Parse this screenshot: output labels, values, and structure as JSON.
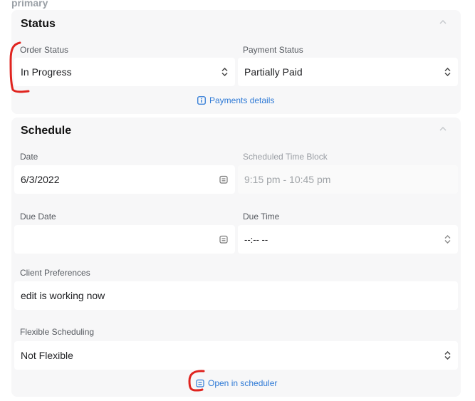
{
  "top_label": "primary",
  "status": {
    "title": "Status",
    "order_status": {
      "label": "Order Status",
      "value": "In Progress"
    },
    "payment_status": {
      "label": "Payment Status",
      "value": "Partially Paid"
    },
    "payments_link": "Payments details"
  },
  "schedule": {
    "title": "Schedule",
    "date": {
      "label": "Date",
      "value": "6/3/2022"
    },
    "time_block": {
      "label": "Scheduled Time Block",
      "value": "9:15 pm - 10:45 pm"
    },
    "due_date": {
      "label": "Due Date",
      "value": ""
    },
    "due_time": {
      "label": "Due Time",
      "value": "--:-- --"
    },
    "client_preferences": {
      "label": "Client Preferences",
      "value": "edit is working now"
    },
    "flexible": {
      "label": "Flexible Scheduling",
      "value": "Not Flexible"
    },
    "scheduler_link": "Open in scheduler"
  },
  "colors": {
    "link": "#2f7ad6",
    "annotation": "#e0241f",
    "card": "#f7f7f8"
  }
}
